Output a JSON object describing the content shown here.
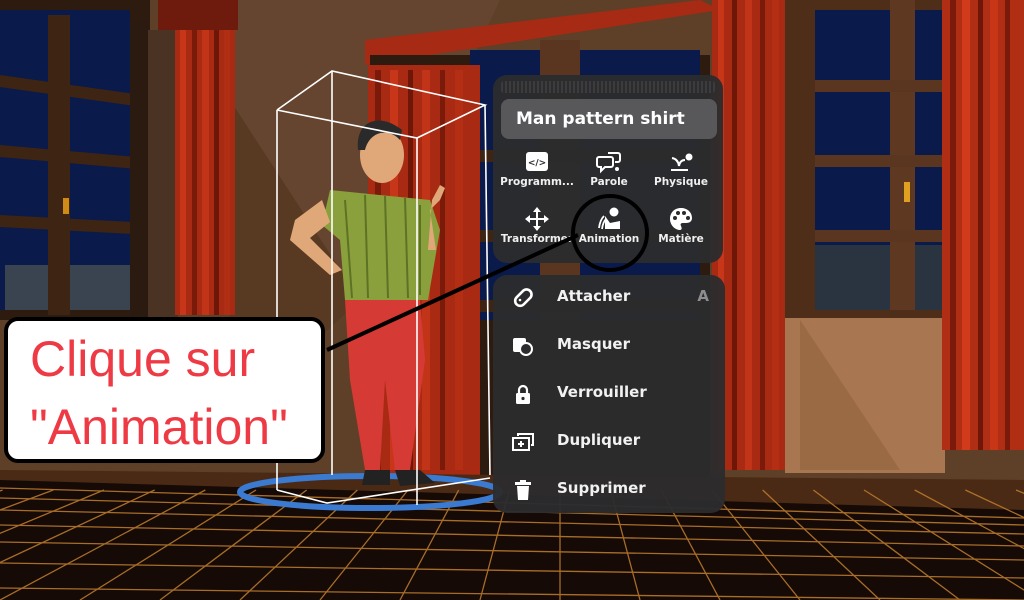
{
  "object_panel": {
    "title": "Man pattern shirt",
    "tools": [
      {
        "label": "Programm...",
        "icon": "code-icon"
      },
      {
        "label": "Parole",
        "icon": "speech-bubbles-icon"
      },
      {
        "label": "Physique",
        "icon": "physics-bounce-icon"
      },
      {
        "label": "Transformer",
        "icon": "move-arrows-icon"
      },
      {
        "label": "Animation",
        "icon": "animation-person-icon"
      },
      {
        "label": "Matière",
        "icon": "palette-icon"
      }
    ]
  },
  "context_menu": {
    "items": [
      {
        "label": "Attacher",
        "icon": "attach-link-icon",
        "shortcut": "A"
      },
      {
        "label": "Masquer",
        "icon": "hide-shapes-icon"
      },
      {
        "label": "Verrouiller",
        "icon": "lock-icon"
      },
      {
        "label": "Dupliquer",
        "icon": "duplicate-icon"
      },
      {
        "label": "Supprimer",
        "icon": "trash-icon"
      }
    ]
  },
  "callout": {
    "line1": "Clique sur",
    "line2": "\"Animation\"",
    "text_color": "#ee3a44"
  },
  "scene": {
    "selected_object": "Man pattern shirt",
    "highlighted_tool": "Animation"
  }
}
